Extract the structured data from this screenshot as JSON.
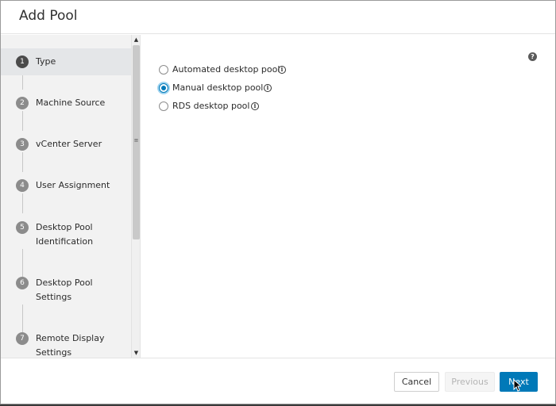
{
  "dialog": {
    "title": "Add Pool"
  },
  "sidebar": {
    "steps": [
      {
        "number": "1",
        "label": "Type",
        "active": true
      },
      {
        "number": "2",
        "label": "Machine Source"
      },
      {
        "number": "3",
        "label": "vCenter Server"
      },
      {
        "number": "4",
        "label": "User Assignment"
      },
      {
        "number": "5",
        "label": "Desktop Pool Identification"
      },
      {
        "number": "6",
        "label": "Desktop Pool Settings"
      },
      {
        "number": "7",
        "label": "Remote Display Settings"
      }
    ],
    "scroll_up_glyph": "▲",
    "scroll_down_glyph": "▼",
    "scroll_grip_glyph": "≡"
  },
  "main": {
    "help_glyph": "?",
    "info_glyph": "i",
    "options": [
      {
        "label": "Automated desktop pool",
        "checked": false
      },
      {
        "label": "Manual desktop pool",
        "checked": true
      },
      {
        "label": "RDS desktop pool",
        "checked": false
      }
    ]
  },
  "footer": {
    "cancel_label": "Cancel",
    "previous_label": "Previous",
    "next_label": "Next"
  },
  "colors": {
    "primary": "#0079b8",
    "sidebar_bg": "#f2f2f2",
    "active_step_bg": "#e4e6e8"
  },
  "icons": {
    "help": "help-circle-icon",
    "info": "info-circle-icon",
    "cursor": "mouse-pointer-icon"
  }
}
